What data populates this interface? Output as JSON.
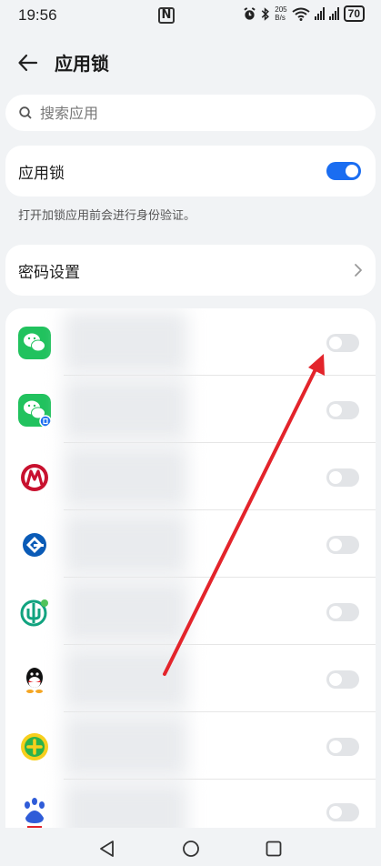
{
  "status": {
    "time": "19:56",
    "speed_value": "205",
    "speed_unit": "B/s",
    "battery": "70"
  },
  "header": {
    "title": "应用锁"
  },
  "search": {
    "placeholder": "搜索应用"
  },
  "app_lock": {
    "label": "应用锁",
    "enabled": true,
    "hint": "打开加锁应用前会进行身份验证。"
  },
  "password": {
    "label": "密码设置"
  },
  "apps": [
    {
      "icon": "wechat-icon",
      "color": "#21c25e",
      "locked": false
    },
    {
      "icon": "wechat-clone-icon",
      "color": "#21c25e",
      "locked": false
    },
    {
      "icon": "cmb-bank-icon",
      "color": "#c8102e",
      "locked": false
    },
    {
      "icon": "ccb-bank-icon",
      "color": "#0a5bb7",
      "locked": false
    },
    {
      "icon": "abc-bank-icon",
      "color": "#11a37f",
      "locked": false
    },
    {
      "icon": "qq-icon",
      "color": "#111111",
      "locked": false
    },
    {
      "icon": "360-icon",
      "color": "#2bb24c",
      "locked": false
    },
    {
      "icon": "baidu-icon",
      "color": "#2f5cd8",
      "locked": false
    }
  ],
  "colors": {
    "accent": "#1a6df1",
    "annotation_arrow": "#e3242b"
  }
}
